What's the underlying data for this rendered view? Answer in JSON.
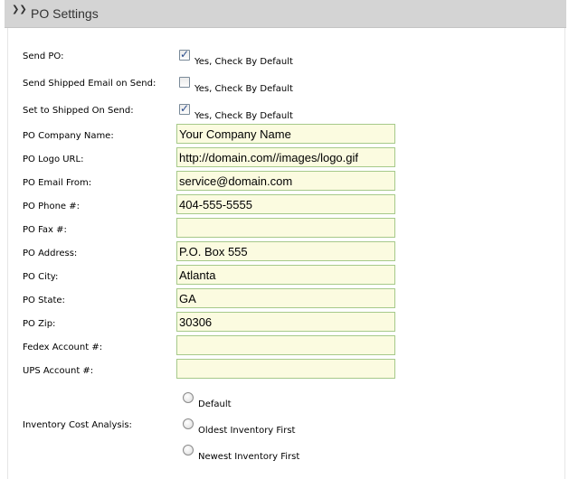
{
  "header": {
    "title": "PO Settings",
    "collapse_icon": "double-chevron-down-icon"
  },
  "checkboxes": [
    {
      "label": "Send PO:",
      "checked": true,
      "text": "Yes, Check By Default"
    },
    {
      "label": "Send Shipped Email on Send:",
      "checked": false,
      "text": "Yes, Check By Default"
    },
    {
      "label": "Set to Shipped On Send:",
      "checked": true,
      "text": "Yes, Check By Default"
    }
  ],
  "fields": [
    {
      "label": "PO Company Name:",
      "value": "Your Company Name"
    },
    {
      "label": "PO Logo URL:",
      "value": "http://domain.com//images/logo.gif"
    },
    {
      "label": "PO Email From:",
      "value": "service@domain.com"
    },
    {
      "label": "PO Phone #:",
      "value": "404-555-5555"
    },
    {
      "label": "PO Fax #:",
      "value": ""
    },
    {
      "label": "PO Address:",
      "value": "P.O. Box 555"
    },
    {
      "label": "PO City:",
      "value": "Atlanta"
    },
    {
      "label": "PO State:",
      "value": "GA"
    },
    {
      "label": "PO Zip:",
      "value": "30306"
    },
    {
      "label": "Fedex Account #:",
      "value": ""
    },
    {
      "label": "UPS Account #:",
      "value": ""
    }
  ],
  "inventory": {
    "label": "Inventory Cost Analysis:",
    "options": [
      "Default",
      "Oldest Inventory First",
      "Newest Inventory First"
    ]
  },
  "colors": {
    "header_bg": "#d4d4d4",
    "input_bg": "#fbfbe0",
    "input_border": "#a6c98a"
  }
}
